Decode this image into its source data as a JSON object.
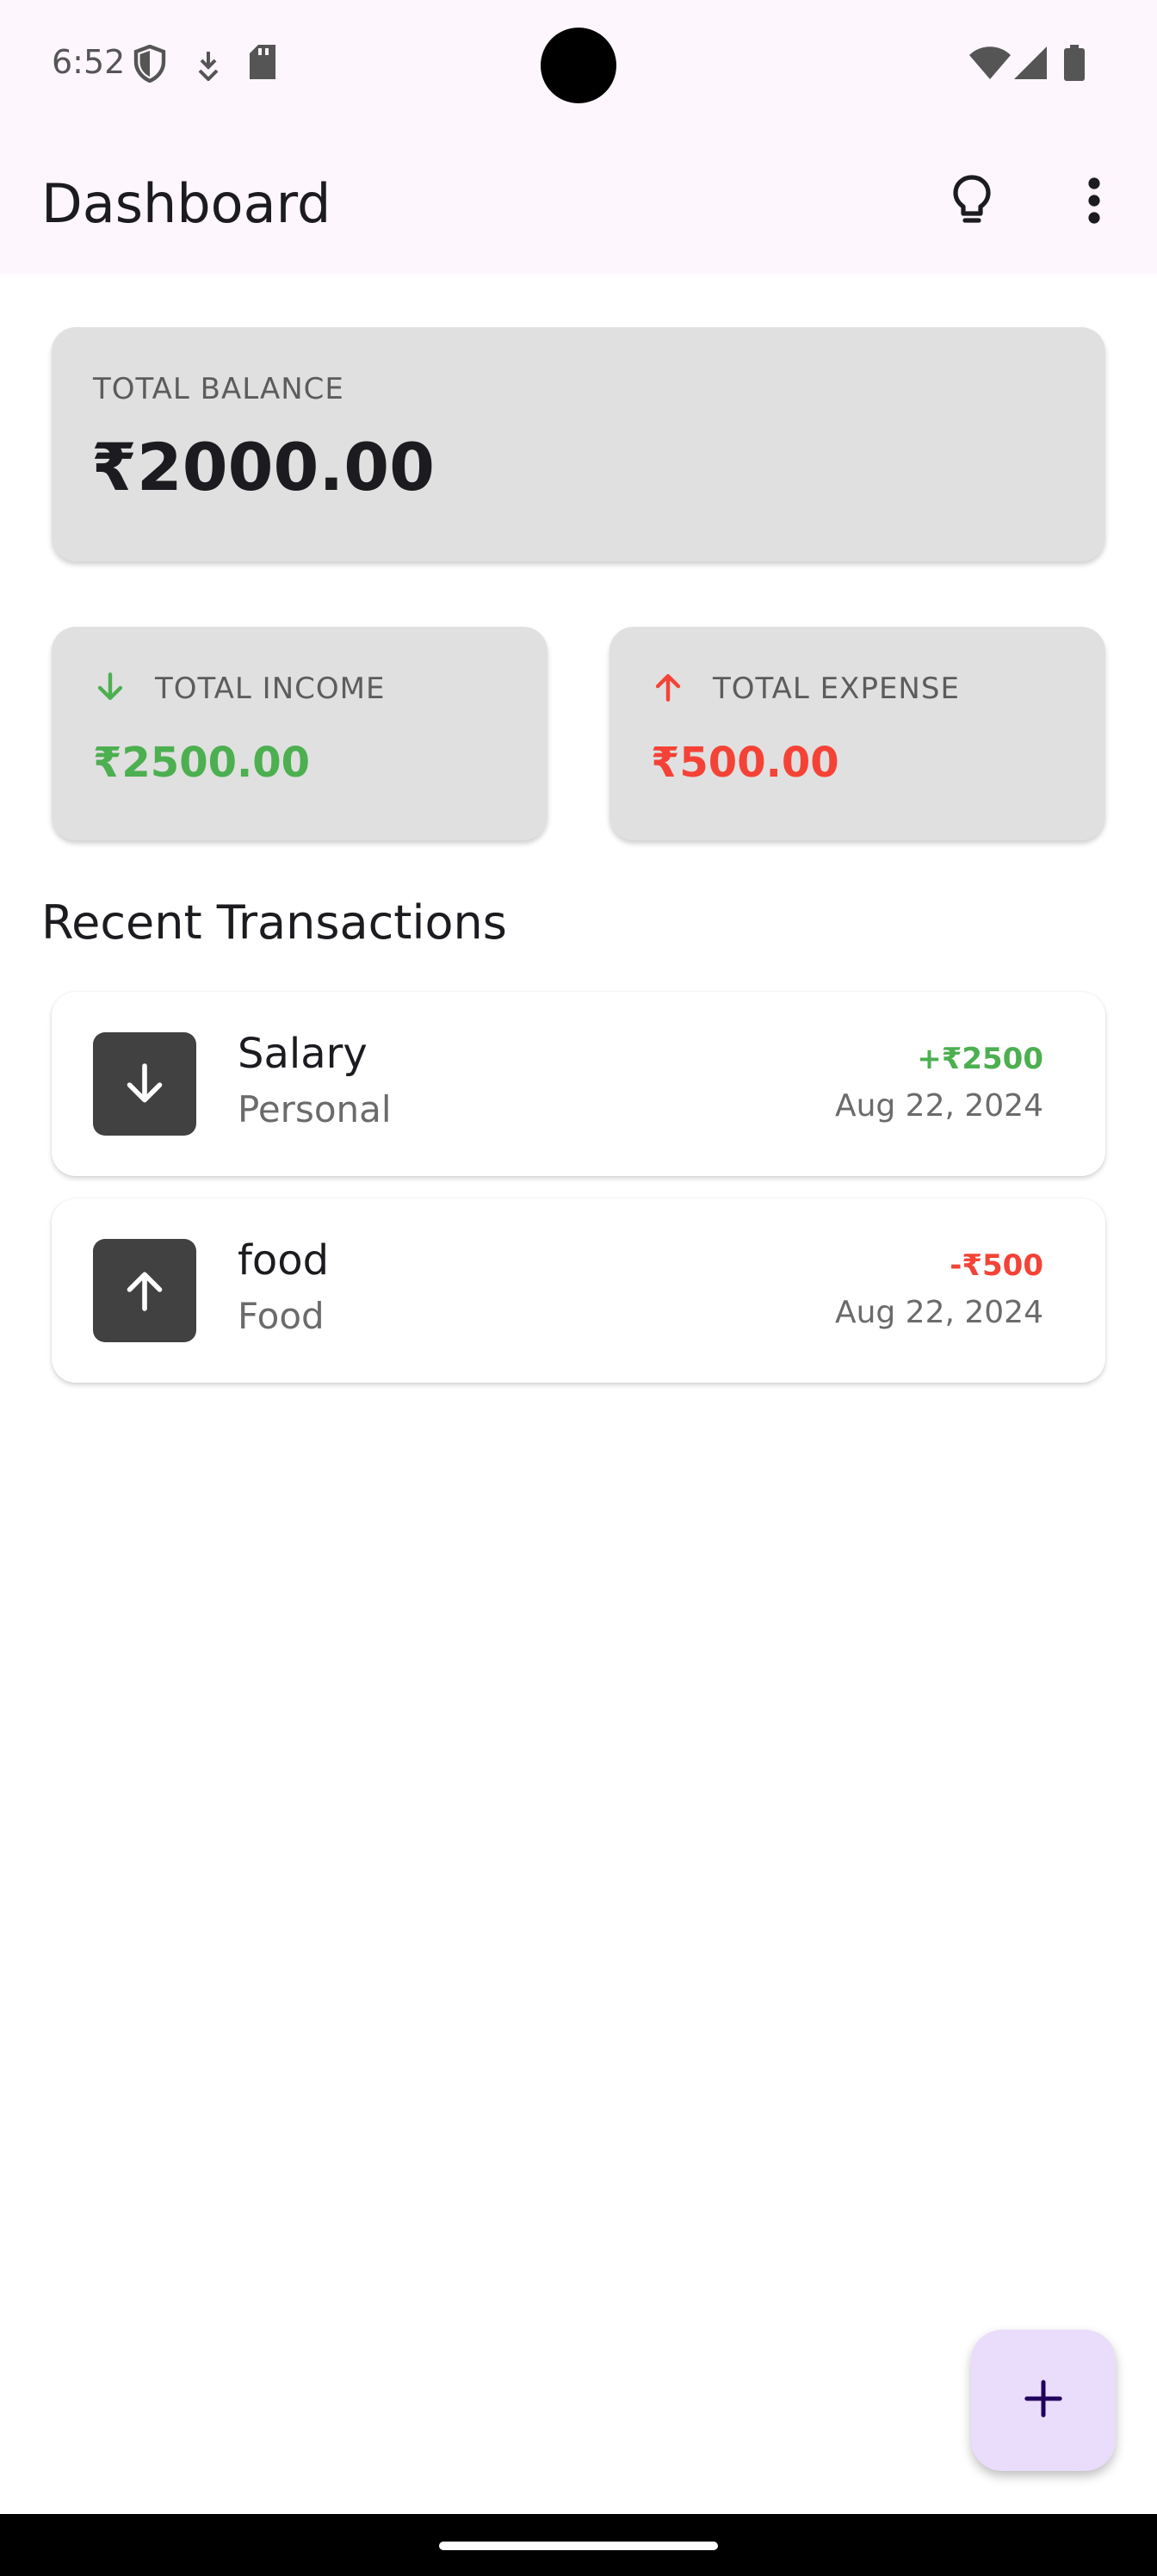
{
  "status_bar": {
    "time": "6:52",
    "icons": [
      "shield-icon",
      "download-icon",
      "sd-card-icon",
      "wifi-icon",
      "signal-icon",
      "battery-icon"
    ]
  },
  "app_bar": {
    "title": "Dashboard",
    "actions": [
      "lightbulb-icon",
      "more-vert-icon"
    ]
  },
  "summary": {
    "balance": {
      "label": "TOTAL BALANCE",
      "amount": "₹2000.00"
    },
    "income": {
      "label": "TOTAL INCOME",
      "amount": "₹2500.00",
      "icon": "arrow-down-icon",
      "color": "#4caf50"
    },
    "expense": {
      "label": "TOTAL EXPENSE",
      "amount": "₹500.00",
      "icon": "arrow-up-icon",
      "color": "#f44336"
    }
  },
  "recent": {
    "title": "Recent Transactions",
    "transactions": [
      {
        "name": "Salary",
        "category": "Personal",
        "amount": "+₹2500",
        "date": "Aug 22, 2024",
        "type": "income",
        "icon": "arrow-down-icon",
        "color": "#4caf50"
      },
      {
        "name": "food",
        "category": "Food",
        "amount": "-₹500",
        "date": "Aug 22, 2024",
        "type": "expense",
        "icon": "arrow-up-icon",
        "color": "#f44336"
      }
    ]
  },
  "fab": {
    "icon": "plus-icon"
  }
}
